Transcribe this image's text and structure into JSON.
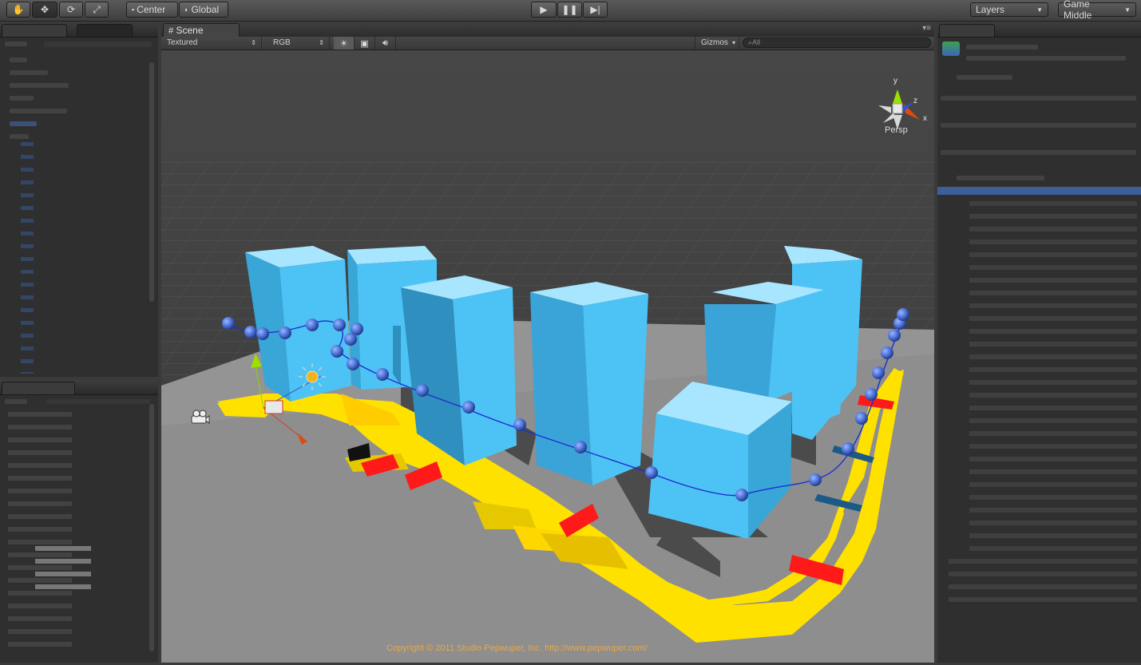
{
  "toolbar": {
    "tools": [
      "hand-icon",
      "move-icon",
      "rotate-icon",
      "scale-icon"
    ],
    "pivot_label": "Center",
    "space_label": "Global",
    "play_controls": [
      "play-icon",
      "pause-icon",
      "step-icon"
    ],
    "layers_label": "Layers",
    "layout_label": "Game Middle"
  },
  "scene": {
    "tab_label": "Scene",
    "render_mode": "Textured",
    "color_mode": "RGB",
    "gizmos_label": "Gizmos",
    "search_placeholder": "All",
    "view_label": "Persp",
    "axes": {
      "x": "x",
      "y": "y",
      "z": "z"
    },
    "copyright": "Copyright © 2011 Studio Pepwuper, Inc. http://www.pepwuper.com/"
  },
  "colors": {
    "building": "#4dc3f5",
    "track": "#ffe100",
    "obstacle": "#ff1a1a",
    "path": "#1e2fd0",
    "node": "#4a6fd6",
    "copyright": "#e6a84a"
  }
}
